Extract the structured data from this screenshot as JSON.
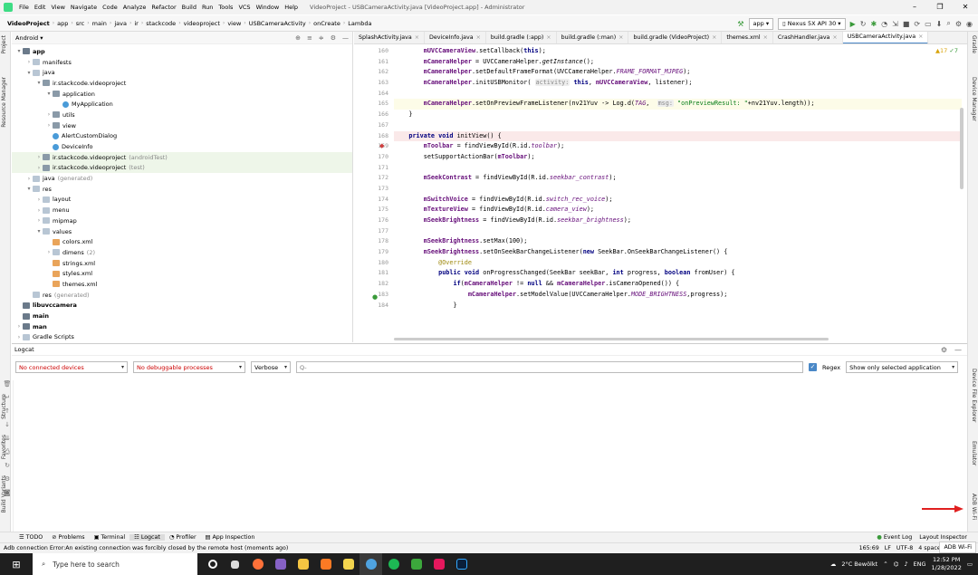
{
  "window": {
    "title": "VideoProject - USBCameraActivity.java [VideoProject.app] - Administrator",
    "menu": [
      "File",
      "Edit",
      "View",
      "Navigate",
      "Code",
      "Analyze",
      "Refactor",
      "Build",
      "Run",
      "Tools",
      "VCS",
      "Window",
      "Help"
    ]
  },
  "breadcrumb": [
    "VideoProject",
    "app",
    "src",
    "main",
    "java",
    "ir",
    "stackcode",
    "videoproject",
    "view",
    "USBCameraActivity",
    "onCreate",
    "Lambda"
  ],
  "toolbar": {
    "config": "app",
    "device": "Nexus 5X API 30"
  },
  "project": {
    "view": "Android",
    "tree": [
      {
        "label": "app",
        "depth": 0,
        "arrow": "▾",
        "icon": "mod",
        "bold": true
      },
      {
        "label": "manifests",
        "depth": 1,
        "arrow": "›",
        "icon": "folder"
      },
      {
        "label": "java",
        "depth": 1,
        "arrow": "▾",
        "icon": "folder"
      },
      {
        "label": "ir.stackcode.videoproject",
        "depth": 2,
        "arrow": "▾",
        "icon": "pkg"
      },
      {
        "label": "application",
        "depth": 3,
        "arrow": "▾",
        "icon": "pkg"
      },
      {
        "label": "MyApplication",
        "depth": 4,
        "arrow": "",
        "icon": "cls"
      },
      {
        "label": "utils",
        "depth": 3,
        "arrow": "›",
        "icon": "pkg"
      },
      {
        "label": "view",
        "depth": 3,
        "arrow": "›",
        "icon": "pkg"
      },
      {
        "label": "AlertCustomDialog",
        "depth": 3,
        "arrow": "",
        "icon": "cls"
      },
      {
        "label": "DeviceInfo",
        "depth": 3,
        "arrow": "",
        "icon": "cls"
      },
      {
        "label": "ir.stackcode.videoproject",
        "depth": 2,
        "arrow": "›",
        "icon": "pkg",
        "suffix": "(androidTest)",
        "hl": true
      },
      {
        "label": "ir.stackcode.videoproject",
        "depth": 2,
        "arrow": "›",
        "icon": "pkg",
        "suffix": "(test)",
        "hl": true
      },
      {
        "label": "java",
        "depth": 1,
        "arrow": "›",
        "icon": "folder",
        "suffix": "(generated)"
      },
      {
        "label": "res",
        "depth": 1,
        "arrow": "▾",
        "icon": "folder"
      },
      {
        "label": "layout",
        "depth": 2,
        "arrow": "›",
        "icon": "folder"
      },
      {
        "label": "menu",
        "depth": 2,
        "arrow": "›",
        "icon": "folder"
      },
      {
        "label": "mipmap",
        "depth": 2,
        "arrow": "›",
        "icon": "folder"
      },
      {
        "label": "values",
        "depth": 2,
        "arrow": "▾",
        "icon": "folder"
      },
      {
        "label": "colors.xml",
        "depth": 3,
        "arrow": "",
        "icon": "xml"
      },
      {
        "label": "dimens",
        "depth": 3,
        "arrow": "›",
        "icon": "folder",
        "suffix": "(2)"
      },
      {
        "label": "strings.xml",
        "depth": 3,
        "arrow": "",
        "icon": "xml"
      },
      {
        "label": "styles.xml",
        "depth": 3,
        "arrow": "",
        "icon": "xml"
      },
      {
        "label": "themes.xml",
        "depth": 3,
        "arrow": "",
        "icon": "xml"
      },
      {
        "label": "res",
        "depth": 1,
        "arrow": "",
        "icon": "folder",
        "suffix": "(generated)"
      },
      {
        "label": "libuvccamera",
        "depth": 0,
        "arrow": "",
        "icon": "mod",
        "bold": true
      },
      {
        "label": "main",
        "depth": 0,
        "arrow": "",
        "icon": "mod",
        "bold": true
      },
      {
        "label": "man",
        "depth": 0,
        "arrow": "›",
        "icon": "mod",
        "bold": true
      },
      {
        "label": "Gradle Scripts",
        "depth": 0,
        "arrow": "›",
        "icon": "folder"
      }
    ]
  },
  "editor": {
    "tabs": [
      {
        "label": "SplashActivity.java"
      },
      {
        "label": "DeviceInfo.java"
      },
      {
        "label": "build.gradle (:app)"
      },
      {
        "label": "build.gradle (:man)"
      },
      {
        "label": "build.gradle (VideoProject)"
      },
      {
        "label": "themes.xml"
      },
      {
        "label": "CrashHandler.java"
      },
      {
        "label": "USBCameraActivity.java",
        "active": true
      }
    ],
    "warnings": "▲17",
    "weak": "✓7",
    "lines": [
      {
        "n": "160",
        "t": "        mUVCCameraView.setCallback(this);"
      },
      {
        "n": "161",
        "t": "        mCameraHelper = UVCCameraHelper.getInstance();"
      },
      {
        "n": "162",
        "t": "        mCameraHelper.setDefaultFrameFormat(UVCCameraHelper.FRAME_FORMAT_MJPEG);"
      },
      {
        "n": "163",
        "t": "        mCameraHelper.initUSBMonitor( activity: this, mUVCCameraView, listener);"
      },
      {
        "n": "164",
        "t": ""
      },
      {
        "n": "165",
        "t": "        mCameraHelper.setOnPreviewFrameListener(nv21Yuv -> Log.d(TAG,  msg: \"onPreviewResult: \"+nv21Yuv.length));",
        "hl": 1
      },
      {
        "n": "166",
        "t": "    }"
      },
      {
        "n": "167",
        "t": ""
      },
      {
        "n": "168",
        "t": "    private void initView() {",
        "hl": 2
      },
      {
        "n": "169",
        "t": "        mToolbar = findViewById(R.id.toolbar);"
      },
      {
        "n": "170",
        "t": "        setSupportActionBar(mToolbar);"
      },
      {
        "n": "171",
        "t": ""
      },
      {
        "n": "172",
        "t": "        mSeekContrast = findViewById(R.id.seekbar_contrast);"
      },
      {
        "n": "173",
        "t": ""
      },
      {
        "n": "174",
        "t": "        mSwitchVoice = findViewById(R.id.switch_rec_voice);"
      },
      {
        "n": "175",
        "t": "        mTextureView = findViewById(R.id.camera_view);"
      },
      {
        "n": "176",
        "t": "        mSeekBrightness = findViewById(R.id.seekbar_brightness);"
      },
      {
        "n": "177",
        "t": ""
      },
      {
        "n": "178",
        "t": "        mSeekBrightness.setMax(100);"
      },
      {
        "n": "179",
        "t": "        mSeekBrightness.setOnSeekBarChangeListener(new SeekBar.OnSeekBarChangeListener() {"
      },
      {
        "n": "180",
        "t": "            @Override"
      },
      {
        "n": "181",
        "t": "            public void onProgressChanged(SeekBar seekBar, int progress, boolean fromUser) {"
      },
      {
        "n": "182",
        "t": "                if(mCameraHelper != null && mCameraHelper.isCameraOpened()) {"
      },
      {
        "n": "183",
        "t": "                    mCameraHelper.setModelValue(UVCCameraHelper.MODE_BRIGHTNESS,progress);"
      },
      {
        "n": "184",
        "t": "                }"
      }
    ]
  },
  "logcat": {
    "title": "Logcat",
    "device": "No connected devices",
    "process": "No debuggable processes",
    "level": "Verbose",
    "search_placeholder": "Q-",
    "regex": "Regex",
    "filter": "Show only selected application"
  },
  "left_strip": [
    "Project",
    "Resource Manager",
    "Structure",
    "Favorites",
    "Build Variants"
  ],
  "right_strip": [
    "Gradle",
    "Device Manager",
    "Device File Explorer",
    "Emulator",
    "ADB Wi-Fi"
  ],
  "bottom_tabs": [
    "TODO",
    "Problems",
    "Terminal",
    "Logcat",
    "Profiler",
    "App Inspection"
  ],
  "bottom_right": [
    "Event Log",
    "Layout Inspector"
  ],
  "status": {
    "message": "Adb connection Error:An existing connection was forcibly closed by the remote host (moments ago)",
    "pos": "165:69",
    "eol": "LF",
    "enc": "UTF-8",
    "indent": "4 spaces",
    "tooltip": "ADB Wi-Fi"
  },
  "taskbar": {
    "search": "Type here to search",
    "weather": "2°C  Bewölkt",
    "lang": "ENG",
    "time": "12:52 PM",
    "date": "1/28/2022"
  },
  "colors": {
    "accent": "#4a88c7",
    "keyword": "#000080",
    "field": "#660e7a",
    "string": "#067d17",
    "arrow": "#e02020"
  }
}
